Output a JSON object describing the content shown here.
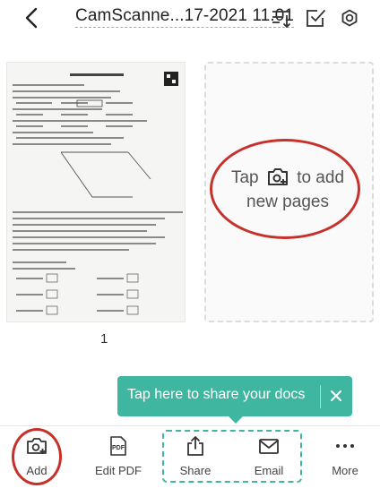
{
  "header": {
    "title": "CamScanne...17-2021 11.01",
    "back_icon": "chevron-left-icon",
    "icons": [
      "sort-icon",
      "multi-select-icon",
      "settings-icon"
    ]
  },
  "pages": [
    {
      "number": "1"
    }
  ],
  "add_card": {
    "line1_before": "Tap",
    "line1_after": "to add",
    "line2": "new pages",
    "icon": "camera-add-icon"
  },
  "tooltip": {
    "text": "Tap here to share your docs",
    "close": "✕"
  },
  "toolbar": {
    "items": [
      {
        "label": "Add",
        "icon": "camera-add-icon"
      },
      {
        "label": "Edit PDF",
        "icon": "pdf-icon"
      },
      {
        "label": "Share",
        "icon": "share-icon"
      },
      {
        "label": "Email",
        "icon": "email-icon"
      },
      {
        "label": "More",
        "icon": "more-icon"
      }
    ]
  },
  "colors": {
    "accent": "#3fb7a0",
    "highlight": "#c7312c",
    "text": "#333333"
  }
}
